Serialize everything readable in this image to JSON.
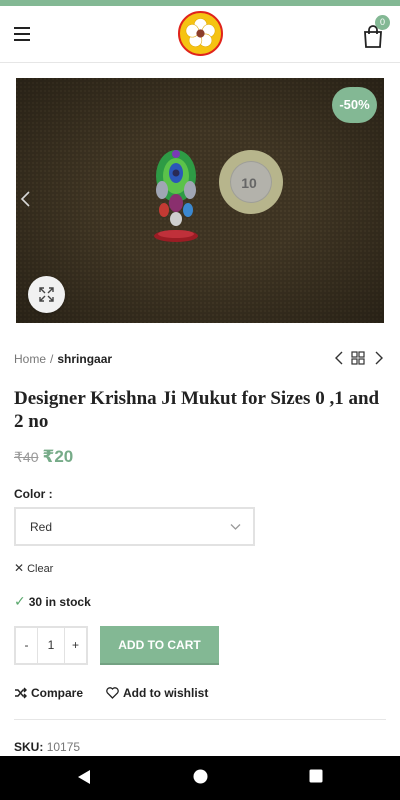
{
  "header": {
    "menu_icon": "hamburger-menu-icon",
    "logo_icon": "flower-logo",
    "cart_icon": "shopping-bag-icon",
    "cart_count": "0"
  },
  "gallery": {
    "sale_badge": "-50%",
    "prev_icon": "chevron-left-icon",
    "zoom_icon": "expand-icon"
  },
  "breadcrumb": {
    "home": "Home",
    "separator": "/",
    "current": "shringaar"
  },
  "product": {
    "title": "Designer Krishna Ji Mukut for Sizes 0 ,1 and 2 no",
    "old_price": "₹40",
    "new_price": "₹20",
    "color_label": "Color :",
    "color_selected": "Red",
    "clear_label": "Clear",
    "stock_text": "30 in stock",
    "quantity": "1",
    "minus_label": "-",
    "plus_label": "+",
    "add_to_cart_label": "ADD TO CART",
    "compare_label": "Compare",
    "wishlist_label": "Add to wishlist",
    "sku_label": "SKU:",
    "sku_value": "10175"
  },
  "colors": {
    "accent": "#83b894",
    "price_green": "#76ab88"
  }
}
